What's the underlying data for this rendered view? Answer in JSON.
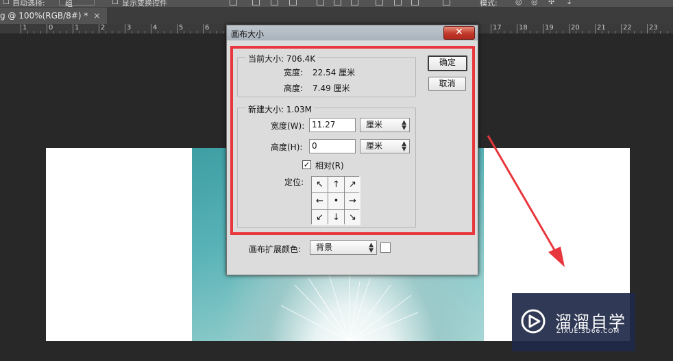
{
  "options_bar": {
    "auto_select_label": "自动选择:",
    "layer_dropdown": "组",
    "show_transform_label": "显示变换控件",
    "extra_label": "模式:"
  },
  "document_tab": {
    "title": "g @ 100%(RGB/8#) *",
    "close": "×"
  },
  "ruler": {
    "labels": [
      "1",
      "0",
      "1",
      "2",
      "3",
      "4",
      "5",
      "6",
      "17",
      "18",
      "19",
      "20",
      "21",
      "22",
      "23"
    ]
  },
  "dialog": {
    "title": "画布大小",
    "close_symbol": "✕",
    "current_size": {
      "legend": "当前大小: 706.4K",
      "width_label": "宽度:",
      "width_value": "22.54 厘米",
      "height_label": "高度:",
      "height_value": "7.49 厘米"
    },
    "new_size": {
      "legend": "新建大小: 1.03M",
      "width_label": "宽度(W):",
      "width_value": "11.27",
      "width_unit": "厘米",
      "height_label": "高度(H):",
      "height_value": "0",
      "height_unit": "厘米",
      "relative_label": "相对(R)",
      "relative_checked": true,
      "anchor_label": "定位:",
      "anchor_arrows": [
        "↖",
        "↑",
        "↗",
        "←",
        "•",
        "→",
        "↙",
        "↓",
        "↘"
      ]
    },
    "extension_color": {
      "label": "画布扩展颜色:",
      "value": "背景",
      "swatch_color": "#ffffff"
    },
    "ok_label": "确定",
    "cancel_label": "取消"
  },
  "highlight_color": "#e8373c",
  "watermark": {
    "title": "溜溜自学",
    "url": "ZIXUE.3D66.COM",
    "icon": "play-logo-icon"
  }
}
